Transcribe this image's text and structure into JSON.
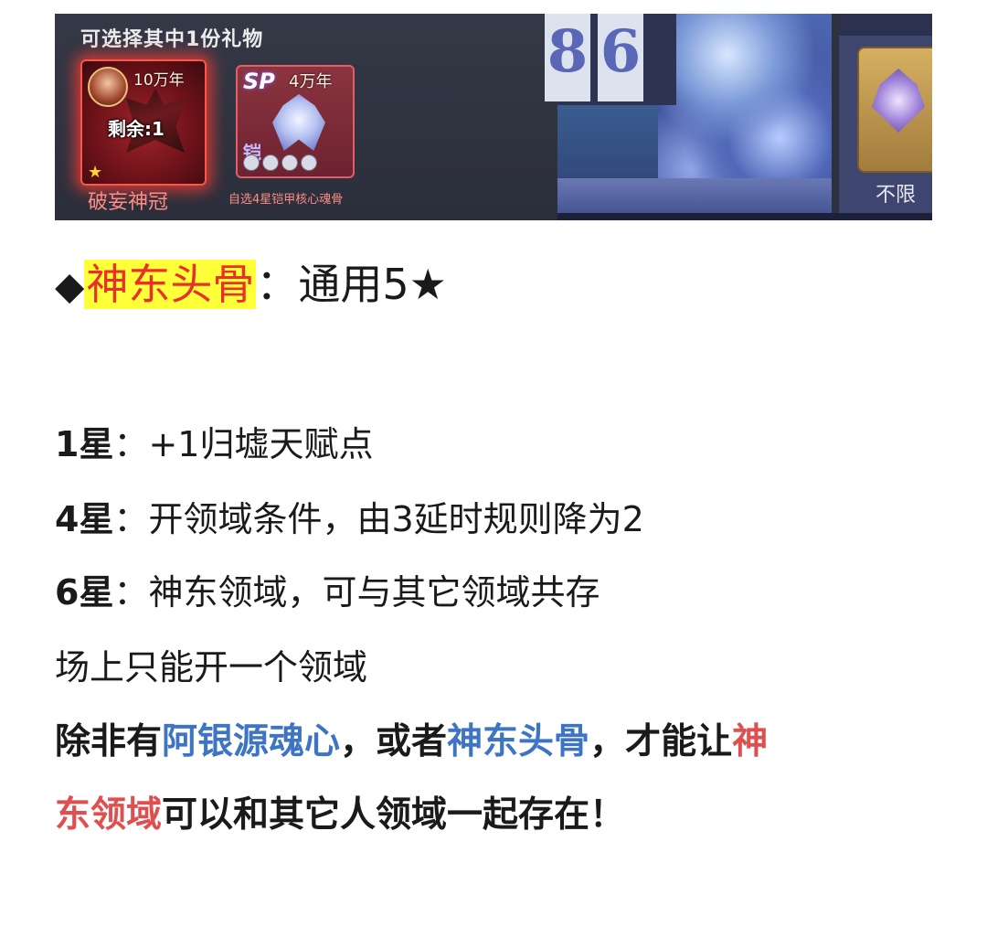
{
  "banner": {
    "gift_title": "可选择其中1份礼物",
    "card1": {
      "age": "10万年",
      "remaining": "剩余:1",
      "star": "★",
      "label": "破妄神冠"
    },
    "card2": {
      "badge": "SP",
      "age": "4万年",
      "type_char": "铠",
      "label": "自选4星铠甲核心魂骨"
    },
    "digits": [
      "8",
      "6"
    ],
    "right_label": "不限"
  },
  "article": {
    "heading": {
      "bullet": "◆",
      "highlight": "神东头骨",
      "rest": "：通用5★"
    },
    "lines": [
      {
        "prefix": "1星",
        "text": "：+1归墟天赋点"
      },
      {
        "prefix": "4星",
        "text": "：开领域条件，由3延时规则降为2"
      },
      {
        "prefix": "6星",
        "text": "：神东领域，可与其它领域共存"
      }
    ],
    "plain_line": "场上只能开一个领域",
    "bold_line1": {
      "a": "除非有",
      "blue1": "阿银源魂心",
      "b": "，或者",
      "blue2": "神东头骨",
      "c": "，才能让",
      "red1": "神"
    },
    "bold_line2": {
      "red2": "东领域",
      "d": "可以和其它人领域一起存在！"
    }
  },
  "colors": {
    "highlight_bg": "#ffff3a",
    "highlight_text": "#e8312b",
    "blue": "#3d74c4",
    "red": "#e04e4e"
  }
}
